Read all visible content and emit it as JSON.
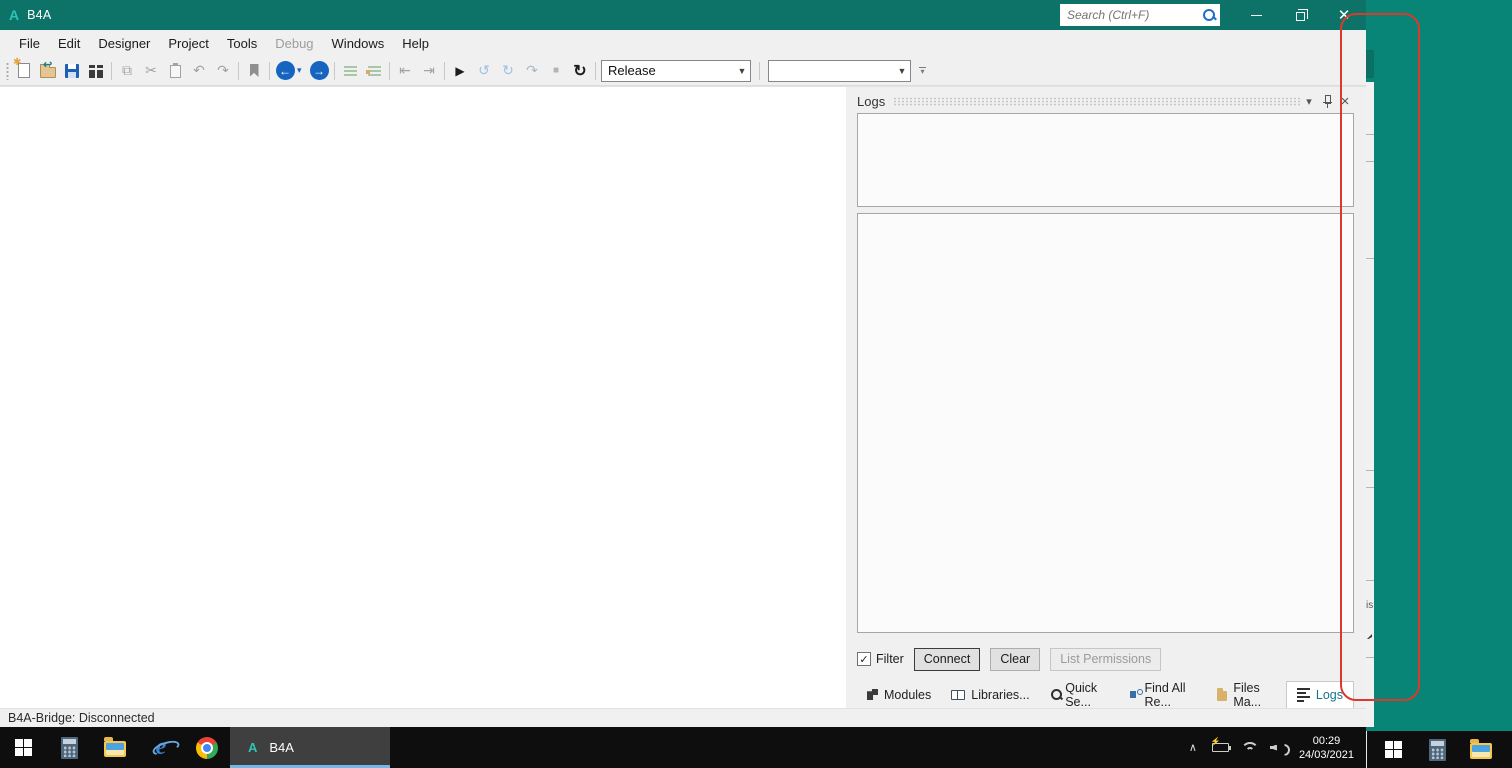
{
  "window": {
    "logo": "A",
    "title": "B4A",
    "search_placeholder": "Search (Ctrl+F)"
  },
  "menu": {
    "items": [
      {
        "label": "File"
      },
      {
        "label": "Edit"
      },
      {
        "label": "Designer"
      },
      {
        "label": "Project"
      },
      {
        "label": "Tools"
      },
      {
        "label": "Debug",
        "enabled": false
      },
      {
        "label": "Windows"
      },
      {
        "label": "Help"
      }
    ]
  },
  "toolbar": {
    "build_configuration": "Release",
    "module_selector": "",
    "icons": {
      "copy": "⧉",
      "cut": "✂",
      "undo": "↶",
      "redo": "↷",
      "back_arrow": "←",
      "forward_arrow": "→",
      "dropdown": "▾",
      "outdent": "⇤",
      "indent": "⇥",
      "run": "▶",
      "step_back": "↺",
      "step_rotate": "↻",
      "step_over": "↷",
      "stop": "■",
      "restart": "↻"
    }
  },
  "logs_panel": {
    "title": "Logs",
    "collapse_icon": "▾",
    "close_icon": "×",
    "filter_label": "Filter",
    "filter_checked": "✓",
    "connect_label": "Connect",
    "clear_label": "Clear",
    "list_permissions_label": "List Permissions"
  },
  "bottom_tabs": [
    {
      "label": "Modules"
    },
    {
      "label": "Libraries..."
    },
    {
      "label": "Quick Se..."
    },
    {
      "label": "Find All Re..."
    },
    {
      "label": "Files Ma..."
    },
    {
      "label": "Logs",
      "active": true
    }
  ],
  "status_bar": {
    "text": "B4A-Bridge: Disconnected"
  },
  "taskbar": {
    "app_logo": "A",
    "app_label": "B4A",
    "tray_chevron": "∧",
    "time": "00:29",
    "date": "24/03/2021"
  },
  "desktop": {
    "sliver_text": "is"
  },
  "colors": {
    "titlebar": "#0d7369",
    "desktop_teal": "#098578",
    "taskbar_black": "#0e0e0e",
    "annotation_red": "#d93a2b",
    "taskbar_underline_blue": "#75b6e7",
    "logo_teal": "#2cc4b5",
    "active_tab_text": "#19758a"
  }
}
